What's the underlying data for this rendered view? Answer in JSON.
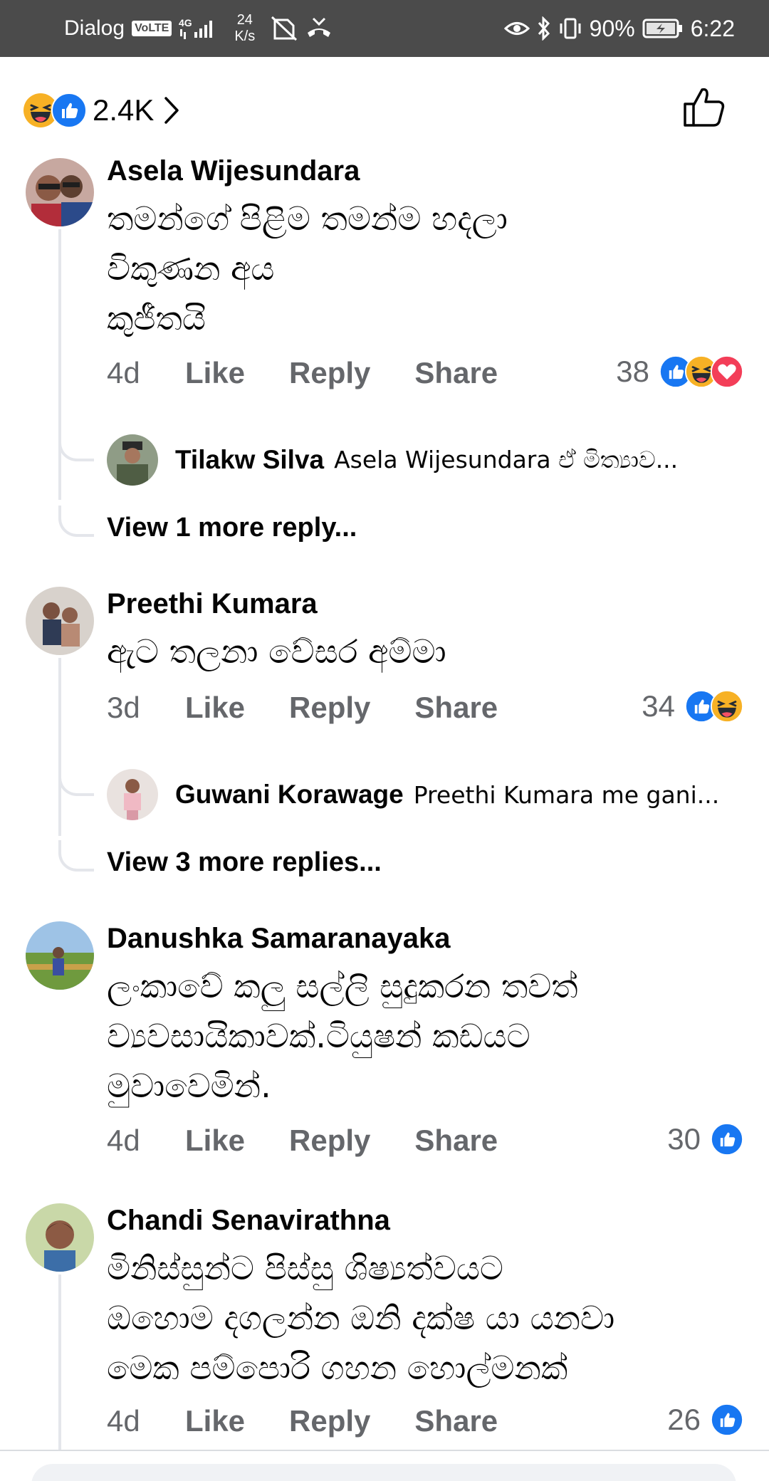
{
  "status_bar": {
    "carrier": "Dialog",
    "volte": "VoLTE",
    "network": "4G",
    "speed_value": "24",
    "speed_unit": "K/s",
    "battery": "90%",
    "time": "6:22"
  },
  "header": {
    "reaction_count": "2.4K",
    "reactions": [
      "haha-emoji",
      "like-emoji"
    ]
  },
  "colors": {
    "like_blue": "#1877f2",
    "haha_yellow": "#f7b125",
    "love_red": "#f33e58",
    "meta_gray": "#65676b",
    "thread_line": "#e4e6eb"
  },
  "comments": [
    {
      "author": "Asela Wijesundara",
      "text": "තමන්ගේ පිළිම තමන්ම හදලා\nවිකුණන අය\n කුජීතයි",
      "time": "4d",
      "like": "Like",
      "reply": "Reply",
      "share": "Share",
      "reaction_count": "38",
      "reactions": [
        "like-emoji",
        "haha-emoji",
        "love-emoji"
      ],
      "reply_preview": {
        "author": "Tilakw Silva",
        "text": "Asela Wijesundara ඒ මිත්‍යාව..."
      },
      "view_more": "View 1 more reply..."
    },
    {
      "author": "Preethi Kumara",
      "text": "ඇට තලනා වේසර අම්මා",
      "time": "3d",
      "like": "Like",
      "reply": "Reply",
      "share": "Share",
      "reaction_count": "34",
      "reactions": [
        "like-emoji",
        "haha-emoji"
      ],
      "reply_preview": {
        "author": "Guwani Korawage",
        "text": "Preethi Kumara me gani..."
      },
      "view_more": "View 3 more replies..."
    },
    {
      "author": "Danushka Samaranayaka",
      "text": "ලංකාවේ කලු සල්ලි සුදුකරන තවත්\nව්‍යවසායිකාවක්.ටියුෂන් කඩයට\nමුවාවෙමින්.",
      "time": "4d",
      "like": "Like",
      "reply": "Reply",
      "share": "Share",
      "reaction_count": "30",
      "reactions": [
        "like-emoji"
      ]
    },
    {
      "author": "Chandi Senavirathna",
      "text": "මිනිස්සුන්ට පිස්සු  ශිෂ්‍යත්වයට\nඔහොම දගලන්න ඔනි දක්ෂ යා යනවා\nමෙක පම්පොරි ගහන හොල්මනක්",
      "time": "4d",
      "like": "Like",
      "reply": "Reply",
      "share": "Share",
      "reaction_count": "26",
      "reactions": [
        "like-emoji"
      ]
    }
  ]
}
